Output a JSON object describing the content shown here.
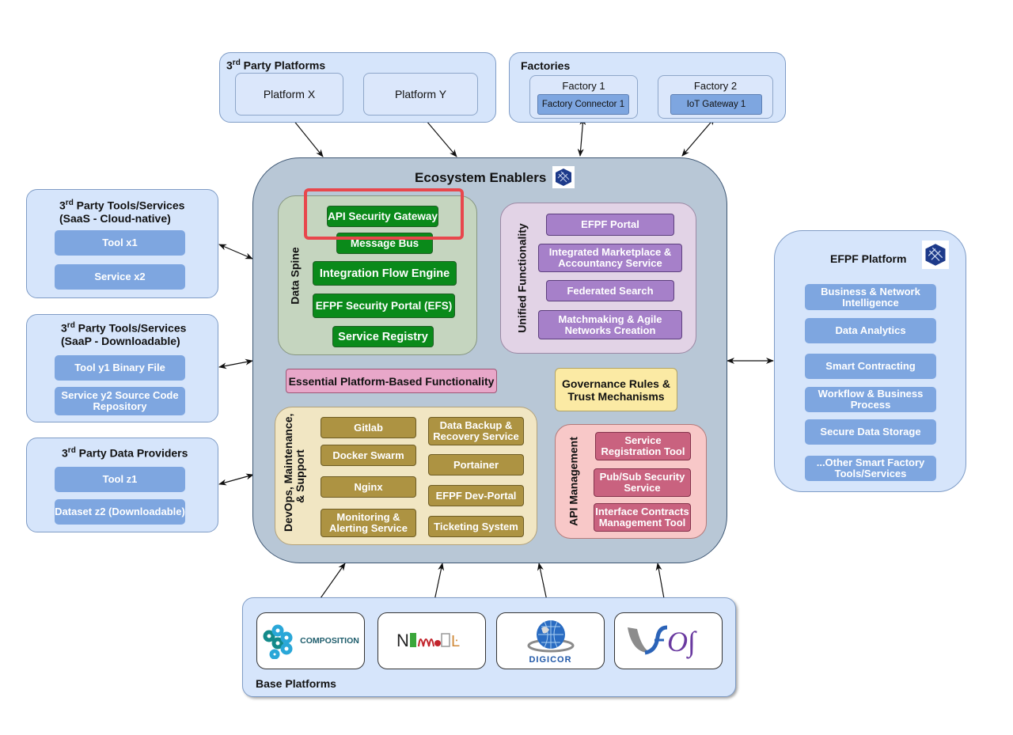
{
  "third_party_platforms": {
    "title_prefix": "3",
    "title_sup": "rd",
    "title_rest": " Party Platforms",
    "items": [
      "Platform X",
      "Platform Y"
    ]
  },
  "factories": {
    "title": "Factories",
    "items": [
      {
        "name": "Factory 1",
        "component": "Factory Connector 1"
      },
      {
        "name": "Factory 2",
        "component": "IoT Gateway 1"
      }
    ]
  },
  "left_groups": [
    {
      "prefix": "3",
      "sup": "rd",
      "rest": " Party Tools/Services",
      "line2": "(SaaS - Cloud-native)",
      "items": [
        "Tool x1",
        "Service x2"
      ]
    },
    {
      "prefix": "3",
      "sup": "rd",
      "rest": " Party Tools/Services",
      "line2": "(SaaP - Downloadable)",
      "items": [
        "Tool y1 Binary File",
        "Service y2 Source Code Repository"
      ]
    },
    {
      "prefix": "3",
      "sup": "rd",
      "rest": " Party Data Providers",
      "line2": "",
      "items": [
        "Tool z1",
        "Dataset z2 (Downloadable)"
      ]
    }
  ],
  "ecosystem": {
    "title": "Ecosystem Enablers",
    "logo_icon": "efpf-cube-icon",
    "data_spine": {
      "label": "Data Spine",
      "items": [
        "API Security Gateway",
        "Message Bus",
        "Integration Flow Engine",
        "EFPF Security Portal (EFS)",
        "Service Registry"
      ],
      "highlighted": "API Security Gateway",
      "highlight_color": "#e8474c"
    },
    "unified": {
      "label": "Unified Functionality",
      "items": [
        "EFPF Portal",
        "Integrated Marketplace & Accountancy Service",
        "Federated Search",
        "Matchmaking & Agile Networks Creation"
      ]
    },
    "essential": "Essential Platform-Based Functionality",
    "governance": "Governance Rules & Trust Mechanisms",
    "devops": {
      "label_line1": "DevOps, Maintenance,",
      "label_line2": "& Support",
      "left_items": [
        "Gitlab",
        "Docker Swarm",
        "Nginx",
        "Monitoring & Alerting Service"
      ],
      "right_items": [
        "Data Backup & Recovery Service",
        "Portainer",
        "EFPF Dev-Portal",
        "Ticketing System"
      ]
    },
    "api_management": {
      "label": "API Management",
      "items": [
        "Service Registration Tool",
        "Pub/Sub Security Service",
        "Interface Contracts Management Tool"
      ]
    }
  },
  "efpf_platform": {
    "title": "EFPF Platform",
    "logo_icon": "efpf-cube-icon",
    "items": [
      "Business & Network Intelligence",
      "Data Analytics",
      "Smart Contracting",
      "Workflow & Business Process",
      "Secure Data Storage",
      "...Other Smart Factory Tools/Services"
    ]
  },
  "base_platforms": {
    "title": "Base Platforms",
    "logos": [
      {
        "name": "COMPOSITION",
        "icon": "composition-chain-icon"
      },
      {
        "name": "NIMBLE",
        "icon": "nimble-logo"
      },
      {
        "name": "DIGICOR",
        "icon": "digicor-globe-icon"
      },
      {
        "name": "vf-OS",
        "icon": "vfos-logo"
      }
    ]
  },
  "colors": {
    "group_bg": "#d6e5fb",
    "ecosystem_bg": "#b8c7d6",
    "blue_item": "#7ea6e0",
    "green_item": "#0a8a1a",
    "purple_item": "#a680c9",
    "olive_item": "#ad9342",
    "rose_item": "#c9627f"
  }
}
